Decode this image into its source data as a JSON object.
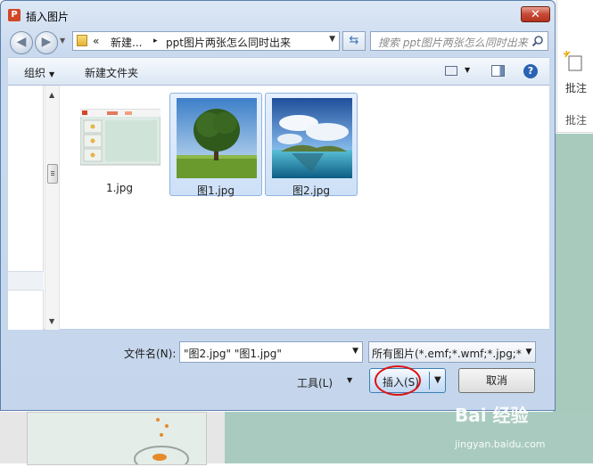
{
  "dialog": {
    "title": "插入图片",
    "close_glyph": "✕"
  },
  "nav": {
    "breadcrumb_prefix": "«",
    "crumb_1": "新建...",
    "crumb_sep": "▸",
    "crumb_2": "ppt图片两张怎么同时出来",
    "search_placeholder": "搜索 ppt图片两张怎么同时出来"
  },
  "toolbar": {
    "organize": "组织",
    "new_folder": "新建文件夹",
    "help": "?"
  },
  "files": [
    {
      "name": "1.jpg",
      "selected": false
    },
    {
      "name": "图1.jpg",
      "selected": true
    },
    {
      "name": "图2.jpg",
      "selected": true
    }
  ],
  "bottom": {
    "filename_label": "文件名(N):",
    "filename_value": "\"图2.jpg\" \"图1.jpg\"",
    "filter_value": "所有图片(*.emf;*.wmf;*.jpg;*.jp",
    "tools_label": "工具(L)",
    "insert_label": "插入(S)",
    "cancel_label": "取消"
  },
  "ribbon": {
    "comment_label": "批注",
    "group_label": "批注"
  },
  "watermark": {
    "brand": "Bai 经验",
    "url": "jingyan.baidu.com"
  },
  "colors": {
    "accent": "#3c7fb1",
    "highlight": "#dd1111",
    "close": "#c74a36"
  }
}
